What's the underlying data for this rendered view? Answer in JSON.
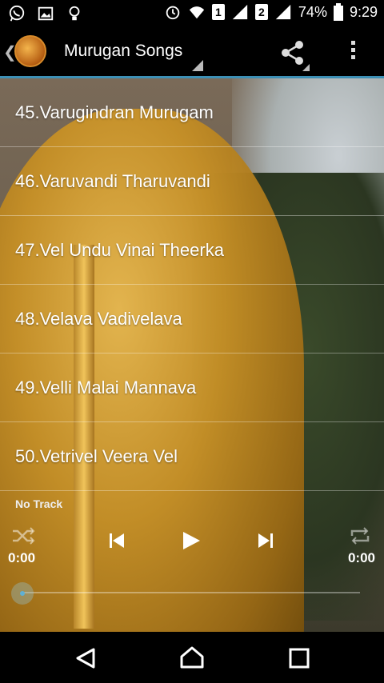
{
  "status_bar": {
    "sim1": "1",
    "sim2": "2",
    "battery": "74%",
    "time": "9:29"
  },
  "app_bar": {
    "title": "Murugan Songs"
  },
  "songs": [
    "45.Varugindran Murugam",
    "46.Varuvandi Tharuvandi",
    "47.Vel Undu Vinai Theerka",
    "48.Velava Vadivelava",
    "49.Velli Malai Mannava",
    "50.Vetrivel Veera Vel"
  ],
  "player": {
    "track": "No Track",
    "elapsed": "0:00",
    "duration": "0:00",
    "progress_fraction": 0
  },
  "colors": {
    "accent": "#3c8fb5"
  },
  "icons": {
    "status_left": [
      "whatsapp-icon",
      "gallery-icon",
      "bulb-icon"
    ],
    "status_right": [
      "alarm-icon",
      "wifi-icon",
      "signal-icon",
      "battery-icon"
    ],
    "app_bar": [
      "back-icon",
      "app-avatar",
      "share-icon",
      "overflow-menu-icon"
    ],
    "player": [
      "shuffle-icon",
      "previous-icon",
      "play-icon",
      "next-icon",
      "repeat-icon"
    ],
    "nav": [
      "back-nav-icon",
      "home-nav-icon",
      "recents-nav-icon"
    ]
  }
}
